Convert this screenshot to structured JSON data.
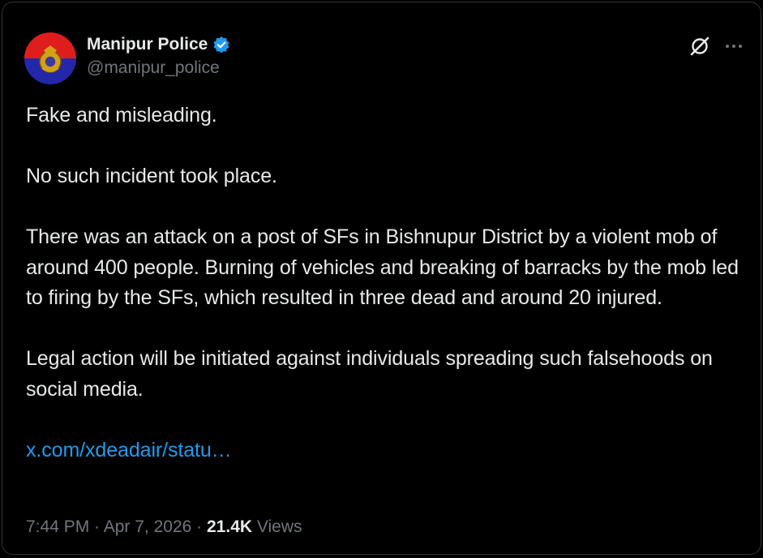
{
  "author": {
    "display_name": "Manipur Police",
    "handle": "@manipur_police",
    "verified": true,
    "avatar_colors": [
      "#e01d1d",
      "#2427a8"
    ]
  },
  "icons": {
    "verified": "verified-badge-icon",
    "grok": "grok-slash-icon",
    "more": "more-dots-icon"
  },
  "post": {
    "paragraphs": [
      "Fake and misleading.",
      "No such incident took place.",
      "There was an attack on a post of SFs in Bishnupur District by a violent mob of around 400 people. Burning of vehicles and breaking of barracks by the mob led to firing by the SFs, which resulted in three dead and around 20 injured.",
      "Legal action will be initiated against individuals spreading such falsehoods on social media."
    ],
    "link_text": "x.com/xdeadair/statu…"
  },
  "meta": {
    "time": "7:44 PM",
    "date": "Apr 7, 2026",
    "separator": " · ",
    "views_count": "21.4K",
    "views_label": "Views"
  },
  "colors": {
    "background": "#000000",
    "text": "#e7e9ea",
    "secondary": "#71767b",
    "link": "#1d9bf0",
    "verified": "#1d9bf0"
  }
}
